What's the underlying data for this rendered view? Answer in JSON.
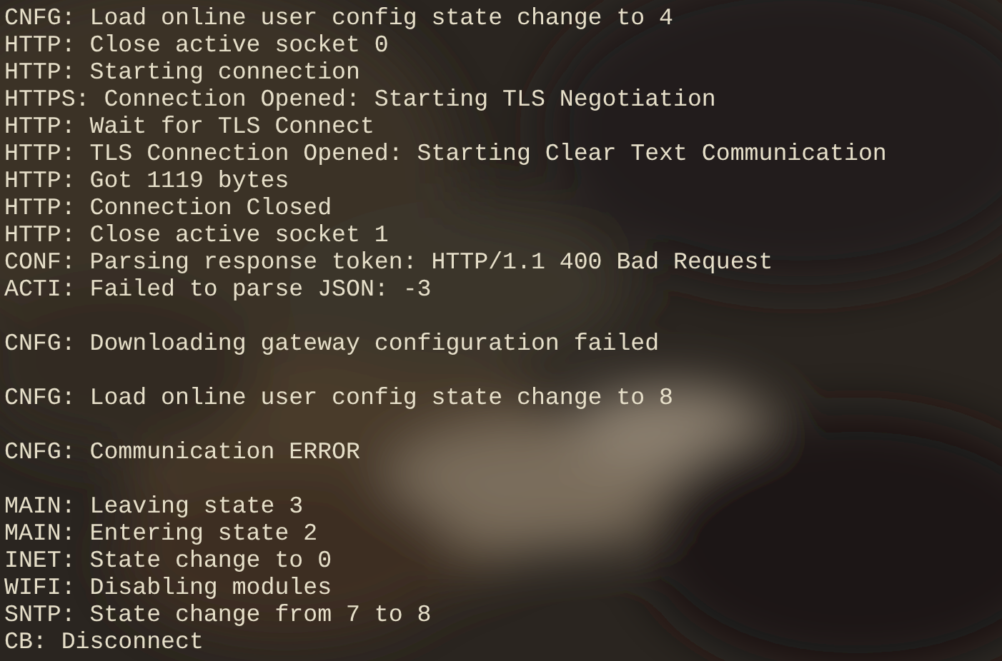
{
  "lines": [
    {
      "kind": "text",
      "text": "CNFG: Load online user config state change to 4"
    },
    {
      "kind": "text",
      "text": "HTTP: Close active socket 0"
    },
    {
      "kind": "text",
      "text": "HTTP: Starting connection"
    },
    {
      "kind": "text",
      "text": "HTTPS: Connection Opened: Starting TLS Negotiation"
    },
    {
      "kind": "text",
      "text": "HTTP: Wait for TLS Connect"
    },
    {
      "kind": "text",
      "text": "HTTP: TLS Connection Opened: Starting Clear Text Communication"
    },
    {
      "kind": "text",
      "text": "HTTP: Got 1119 bytes"
    },
    {
      "kind": "text",
      "text": "HTTP: Connection Closed"
    },
    {
      "kind": "text",
      "text": "HTTP: Close active socket 1"
    },
    {
      "kind": "text",
      "text": "CONF: Parsing response token: HTTP/1.1 400 Bad Request"
    },
    {
      "kind": "text",
      "text": "ACTI: Failed to parse JSON: -3"
    },
    {
      "kind": "blank"
    },
    {
      "kind": "text",
      "text": "CNFG: Downloading gateway configuration failed"
    },
    {
      "kind": "blank"
    },
    {
      "kind": "text",
      "text": "CNFG: Load online user config state change to 8"
    },
    {
      "kind": "blank"
    },
    {
      "kind": "text",
      "text": "CNFG: Communication ERROR"
    },
    {
      "kind": "blank"
    },
    {
      "kind": "text",
      "text": "MAIN: Leaving state 3"
    },
    {
      "kind": "text",
      "text": "MAIN: Entering state 2"
    },
    {
      "kind": "text",
      "text": "INET: State change to 0"
    },
    {
      "kind": "text",
      "text": "WIFI: Disabling modules"
    },
    {
      "kind": "text",
      "text": "SNTP: State change from 7 to 8"
    },
    {
      "kind": "text",
      "text": "CB: Disconnect"
    }
  ]
}
